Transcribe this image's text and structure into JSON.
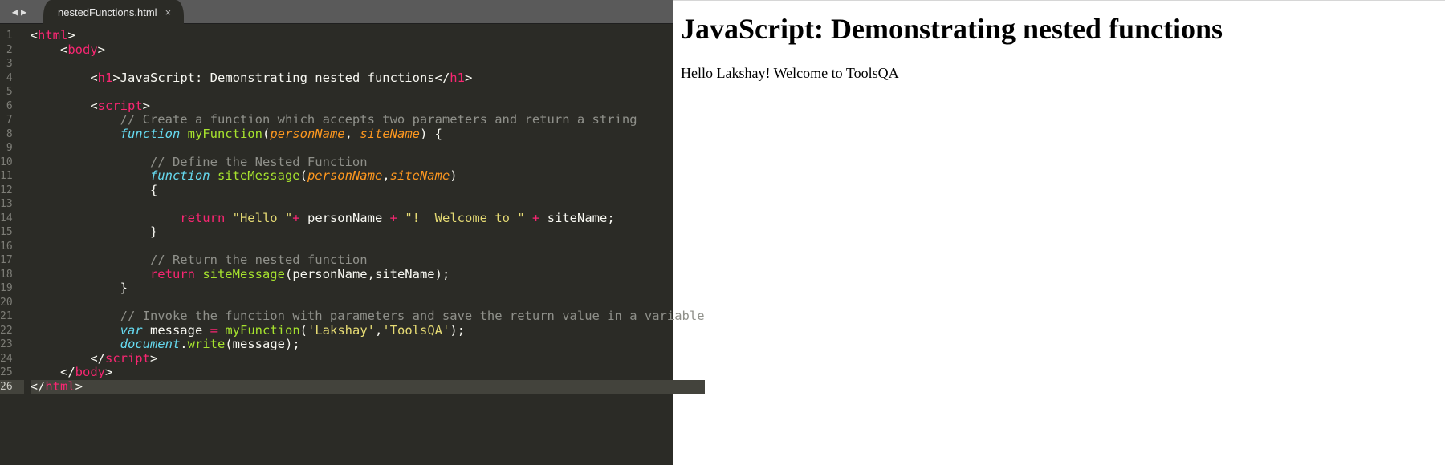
{
  "editor": {
    "nav": {
      "back_glyph": "◀",
      "forward_glyph": "▶"
    },
    "tab": {
      "title": "nestedFunctions.html",
      "close_glyph": "×"
    },
    "line_count": 26,
    "active_line": 26,
    "tokens": {
      "html": "html",
      "body": "body",
      "h1": "h1",
      "script": "script",
      "function_kw": "function",
      "return_kw": "return",
      "var_kw": "var",
      "myFunction": "myFunction",
      "siteMessage": "siteMessage",
      "personName": "personName",
      "siteName": "siteName",
      "message": "message",
      "document": "document",
      "write": "write",
      "h1_text": "JavaScript: Demonstrating nested functions",
      "str_hello": "\"Hello \"",
      "str_excl": "\"!  Welcome to \"",
      "str_lakshay": "'Lakshay'",
      "str_toolsqa": "'ToolsQA'",
      "c1": "// Create a function which accepts two parameters and return a string",
      "c2": "// Define the Nested Function",
      "c3": "// Return the nested function",
      "c4": "// Invoke the function with parameters and save the return value in a variable"
    }
  },
  "browser": {
    "heading": "JavaScript: Demonstrating nested functions",
    "body_text": "Hello Lakshay! Welcome to ToolsQA"
  }
}
